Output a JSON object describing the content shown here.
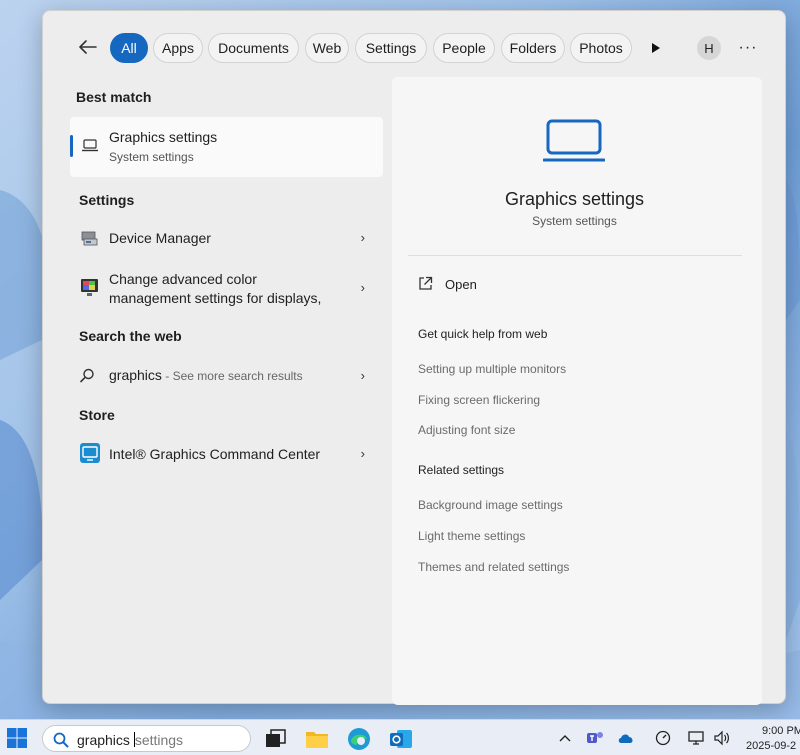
{
  "tabs": {
    "items": [
      {
        "label": "All",
        "active": true
      },
      {
        "label": "Apps"
      },
      {
        "label": "Documents"
      },
      {
        "label": "Web"
      },
      {
        "label": "Settings"
      },
      {
        "label": "People"
      },
      {
        "label": "Folders"
      },
      {
        "label": "Photos"
      }
    ],
    "avatar_letter": "H",
    "more_label": "···"
  },
  "results": {
    "best_match_heading": "Best match",
    "best_match": {
      "title": "Graphics settings",
      "subtitle": "System settings",
      "icon": "laptop-icon"
    },
    "settings_heading": "Settings",
    "settings_items": [
      {
        "label": "Device Manager",
        "icon": "device-manager-icon"
      },
      {
        "label_line1": "Change advanced color",
        "label_line2": "management settings for displays,",
        "icon": "color-management-icon"
      }
    ],
    "web_heading": "Search the web",
    "web_item": {
      "query": "graphics",
      "hint": " - See more search results",
      "icon": "search-icon"
    },
    "store_heading": "Store",
    "store_item": {
      "label": "Intel® Graphics Command Center",
      "icon": "intel-app-icon"
    }
  },
  "preview": {
    "title": "Graphics settings",
    "subtitle": "System settings",
    "open_label": "Open",
    "quick_help_heading": "Get quick help from web",
    "quick_help_links": [
      "Setting up multiple monitors",
      "Fixing screen flickering",
      "Adjusting font size"
    ],
    "related_heading": "Related settings",
    "related_links": [
      "Background image settings",
      "Light theme settings",
      "Themes and related settings"
    ]
  },
  "taskbar": {
    "search_typed": "graphics ",
    "search_suggestion": "settings",
    "time": "9:00 PM",
    "date": "2025-09-2"
  },
  "colors": {
    "accent": "#1667c0",
    "panel": "#ededed",
    "preview": "#f6f6f6"
  }
}
